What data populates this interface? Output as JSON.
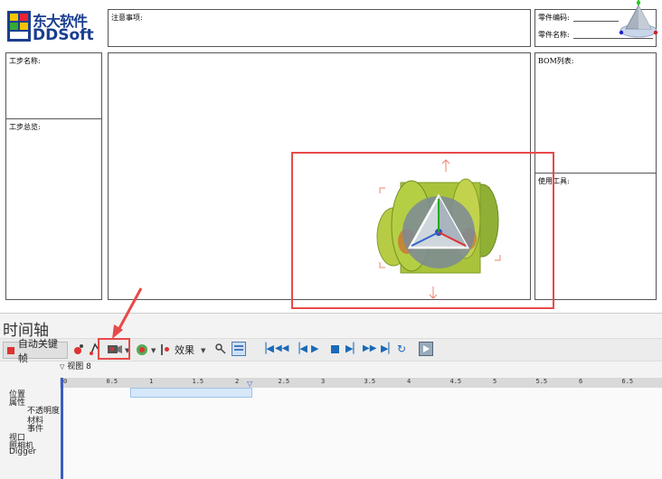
{
  "logo": {
    "cn": "东大软件",
    "en": "DDSoft"
  },
  "sheet": {
    "notes_label": "注意事项:",
    "part_number_label": "零件编码:",
    "part_name_label": "零件名称:",
    "step_name_label": "工步名称:",
    "step_overview_label": "工步总览:",
    "bom_label": "BOM列表:",
    "tools_label": "使用工具:"
  },
  "timeline": {
    "title": "时间轴",
    "auto_keyframe_label": "自动关键帧",
    "effects_label": "效果",
    "view_label": "视图 8",
    "ruler_ticks": [
      "0",
      "0.5",
      "1",
      "1.5",
      "2",
      "2.5",
      "3",
      "3.5",
      "4",
      "4.5",
      "5",
      "5.5",
      "6",
      "6.5"
    ],
    "tracks": [
      {
        "label": "位置",
        "indent": 0
      },
      {
        "label": "属性",
        "indent": 0
      },
      {
        "label": "不透明度",
        "indent": 2
      },
      {
        "label": "材料",
        "indent": 2
      },
      {
        "label": "事件",
        "indent": 2
      },
      {
        "label": "视口",
        "indent": 0
      },
      {
        "label": "照相机",
        "indent": 0
      },
      {
        "label": "Digger",
        "indent": 0
      }
    ]
  },
  "colors": {
    "highlight": "#e84a4a",
    "brand": "#1a3e8e",
    "model": "#a9c43a"
  }
}
